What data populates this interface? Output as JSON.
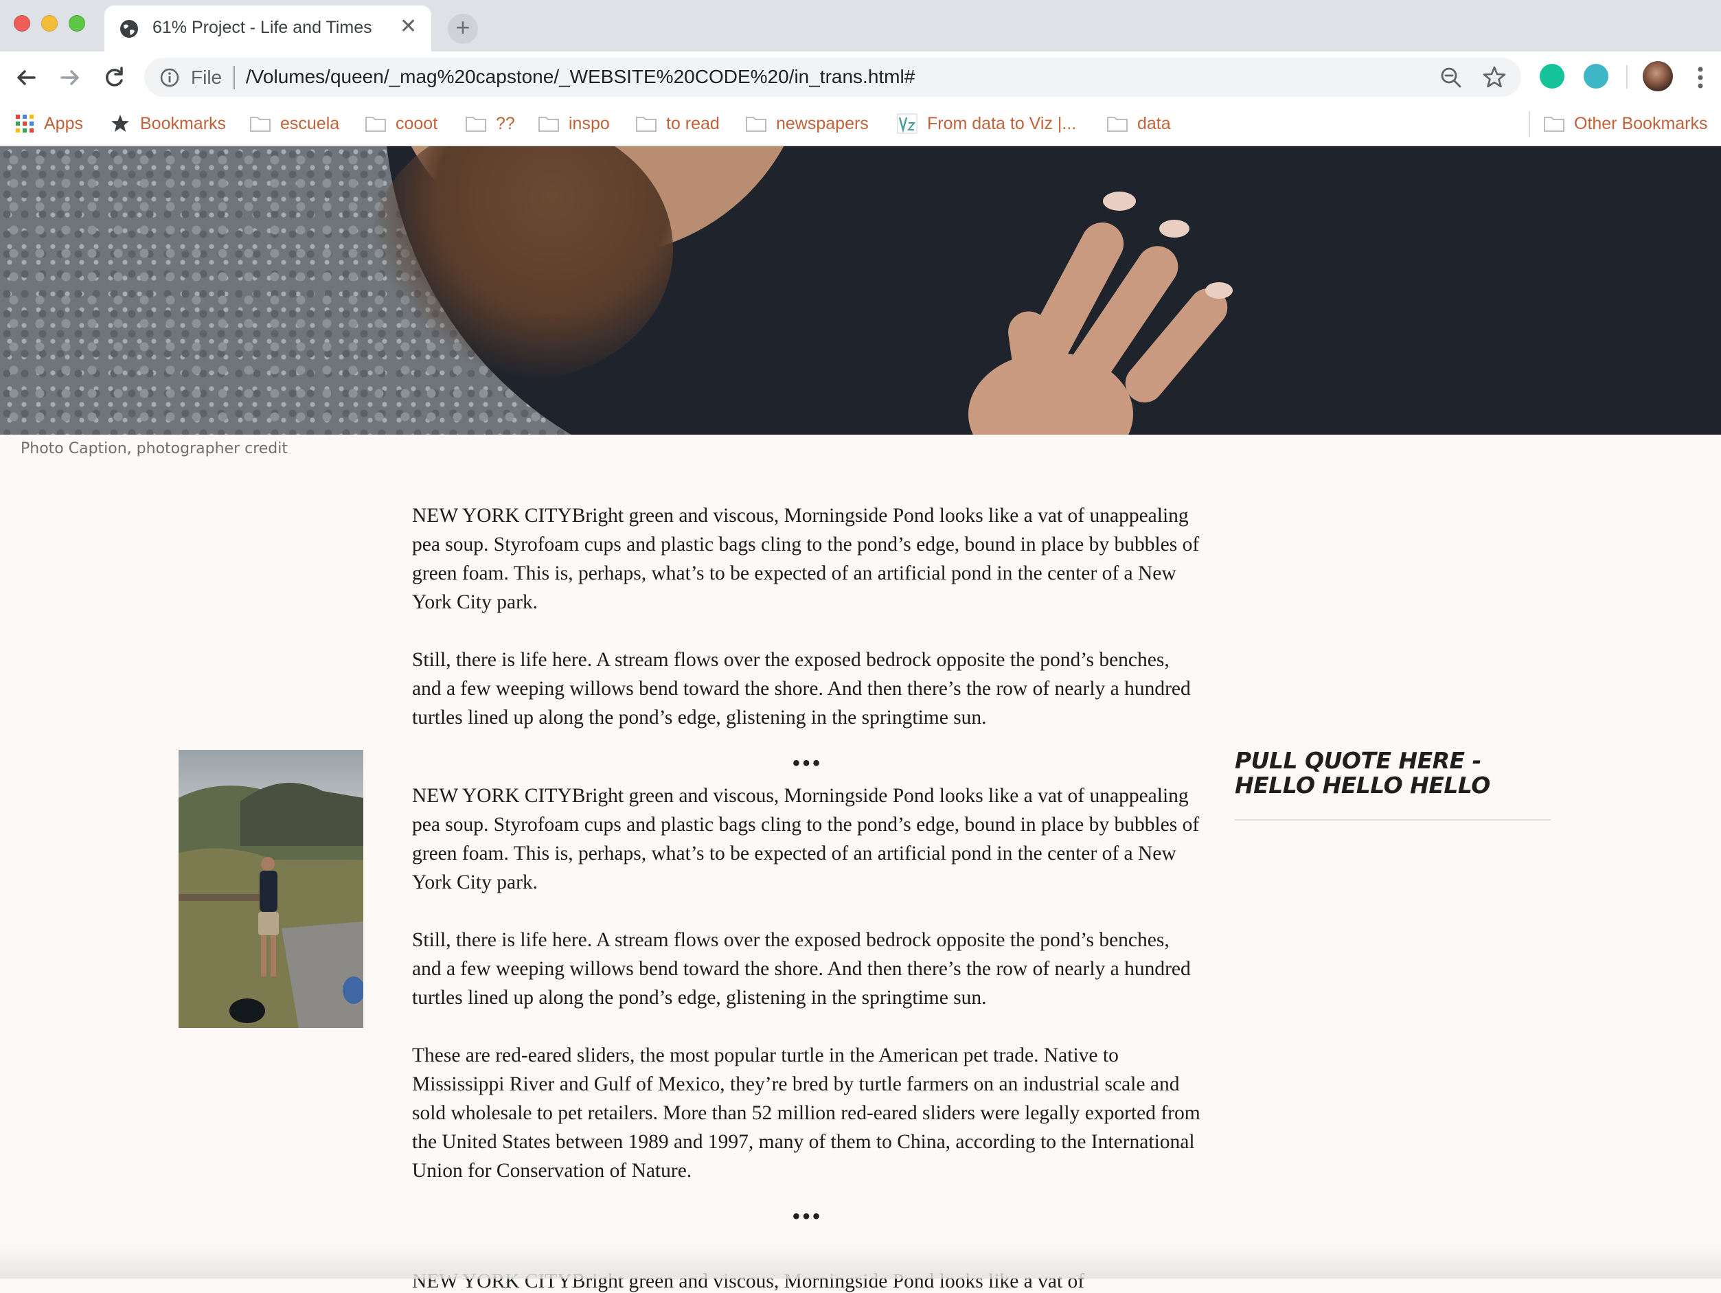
{
  "browser": {
    "tab_title": "61% Project - Life and Times",
    "tab_close": "✕",
    "new_tab": "+",
    "address_scheme": "File",
    "address_url": "/Volumes/queen/_mag%20capstone/_WEBSITE%20CODE%20/in_trans.html#"
  },
  "bookmarks": [
    {
      "label": "Apps",
      "icon": "apps-grid-icon"
    },
    {
      "label": "Bookmarks",
      "icon": "star-icon"
    },
    {
      "label": "escuela",
      "icon": "folder-icon"
    },
    {
      "label": "cooot",
      "icon": "folder-icon"
    },
    {
      "label": "??",
      "icon": "folder-icon"
    },
    {
      "label": "inspo",
      "icon": "folder-icon"
    },
    {
      "label": "to read",
      "icon": "folder-icon"
    },
    {
      "label": "newspapers",
      "icon": "folder-icon"
    },
    {
      "label": "From data to Viz |...",
      "icon": "viz-favicon-icon"
    },
    {
      "label": "data",
      "icon": "folder-icon"
    }
  ],
  "other_bookmarks": "Other Bookmarks",
  "page": {
    "photo_caption": "Photo Caption, photographer credit",
    "paragraphs_1": [
      "NEW YORK CITYBright green and viscous, Morningside Pond looks like a vat of unappealing pea soup. Styrofoam cups and plastic bags cling to the pond’s edge, bound in place by bubbles of green foam. This is, perhaps, what’s to be expected of an artificial pond in the center of a New York City park.",
      "Still, there is life here. A stream flows over the exposed bedrock opposite the pond’s benches, and a few weeping willows bend toward the shore. And then there’s the row of nearly a hundred turtles lined up along the pond’s edge, glistening in the springtime sun."
    ],
    "separator": "•••",
    "paragraphs_2": [
      "NEW YORK CITYBright green and viscous, Morningside Pond looks like a vat of unappealing pea soup. Styrofoam cups and plastic bags cling to the pond’s edge, bound in place by bubbles of green foam. This is, perhaps, what’s to be expected of an artificial pond in the center of a New York City park.",
      "Still, there is life here. A stream flows over the exposed bedrock opposite the pond’s benches, and a few weeping willows bend toward the shore. And then there’s the row of nearly a hundred turtles lined up along the pond’s edge, glistening in the springtime sun.",
      "These are red-eared sliders, the most popular turtle in the American pet trade. Native to Mississippi River and Gulf of Mexico, they’re bred by turtle farmers on an industrial scale and sold wholesale to pet retailers. More than 52 million red-eared sliders were legally exported from the United States between 1989 and 1997, many of them to China, according to the International Union for Conservation of Nature."
    ],
    "cut_off_line": "NEW YORK CITYBright green and viscous, Morningside Pond looks like a vat of",
    "pull_quote": "PULL QUOTE HERE - HELLO HELLO HELLO"
  },
  "colors": {
    "page_background": "#fcf9f6",
    "bookmark_text": "#c0623a",
    "tab_strip": "#dee1e6"
  }
}
